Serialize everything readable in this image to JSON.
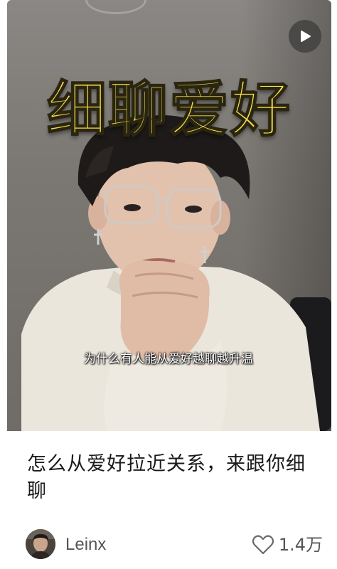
{
  "video": {
    "overlay_title": "细聊爱好",
    "subtitle": "为什么有人能从爱好越聊越升温",
    "play_icon": "play-icon"
  },
  "post": {
    "title": "怎么从爱好拉近关系，来跟你细聊"
  },
  "author": {
    "name": "Leinx",
    "avatar_icon": "avatar"
  },
  "likes": {
    "icon": "heart-icon",
    "count": "1.4万"
  },
  "colors": {
    "overlay_title": "#f5e04c",
    "text_primary": "#1a1a1a",
    "text_secondary": "#555555"
  }
}
